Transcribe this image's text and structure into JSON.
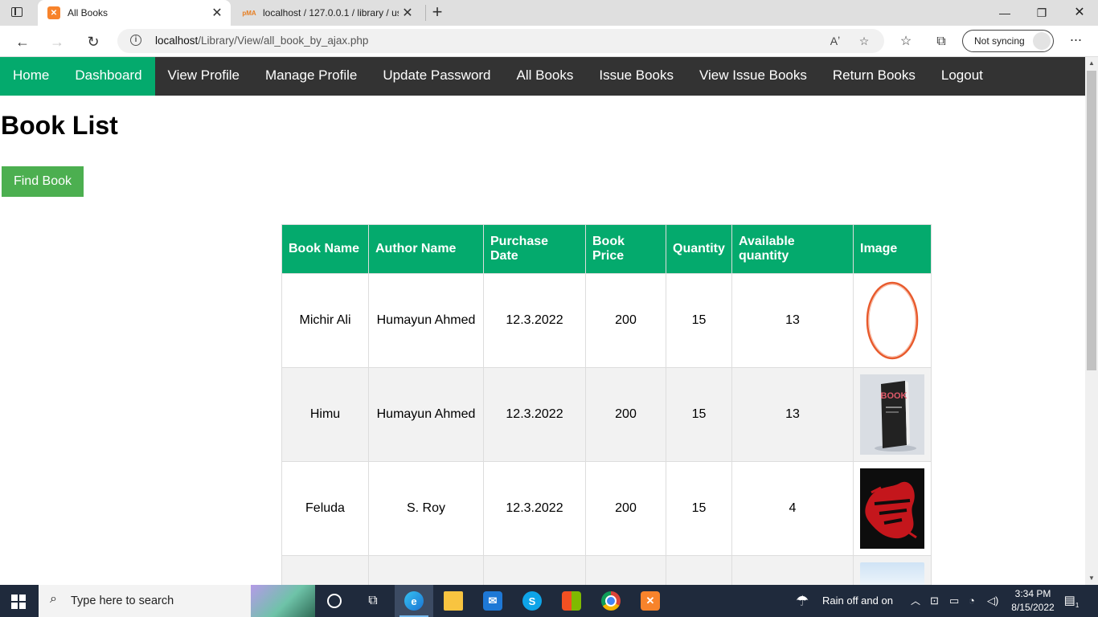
{
  "browser": {
    "tabs": [
      {
        "title": "All Books",
        "favicon": "xampp-icon",
        "active": true
      },
      {
        "title": "localhost / 127.0.0.1 / library / us",
        "favicon": "phpmyadmin-icon",
        "active": false
      }
    ],
    "url": {
      "host": "localhost",
      "path": "/Library/View/all_book_by_ajax.php"
    },
    "sync_label": "Not syncing"
  },
  "nav": {
    "items": [
      {
        "label": "Home",
        "highlighted": true
      },
      {
        "label": "Dashboard",
        "highlighted": true
      },
      {
        "label": "View Profile",
        "highlighted": false
      },
      {
        "label": "Manage Profile",
        "highlighted": false
      },
      {
        "label": "Update Password",
        "highlighted": false
      },
      {
        "label": "All Books",
        "highlighted": false
      },
      {
        "label": "Issue Books",
        "highlighted": false
      },
      {
        "label": "View Issue Books",
        "highlighted": false
      },
      {
        "label": "Return Books",
        "highlighted": false
      },
      {
        "label": "Logout",
        "highlighted": false
      }
    ]
  },
  "page": {
    "title": "Book List",
    "find_button": "Find Book"
  },
  "table": {
    "headers": {
      "book_name": "Book Name",
      "author_name": "Author Name",
      "purchase_date_1": "Purchase",
      "purchase_date_2": "Date",
      "book_price_1": "Book",
      "book_price_2": "Price",
      "quantity": "Quantity",
      "available_1": "Available",
      "available_2": "quantity",
      "image": "Image"
    },
    "rows": [
      {
        "book_name": "Michir Ali",
        "author": "Humayun Ahmed",
        "purchase_date": "12.3.2022",
        "price": "200",
        "quantity": "15",
        "available": "13",
        "image": "ring-cover-image"
      },
      {
        "book_name": "Himu",
        "author": "Humayun Ahmed",
        "purchase_date": "12.3.2022",
        "price": "200",
        "quantity": "15",
        "available": "13",
        "image": "book-mockup-cover-image",
        "cover_text": "BOOK"
      },
      {
        "book_name": "Feluda",
        "author": "S. Roy",
        "purchase_date": "12.3.2022",
        "price": "200",
        "quantity": "15",
        "available": "4",
        "image": "red-black-cover-image"
      }
    ]
  },
  "taskbar": {
    "search_placeholder": "Type here to search",
    "weather": "Rain off and on",
    "time": "3:34 PM",
    "date": "8/15/2022",
    "notification_count": "1"
  },
  "colors": {
    "nav_bg": "#333333",
    "nav_highlight": "#04aa6d",
    "table_header": "#04aa6d",
    "find_button": "#4caf50",
    "taskbar": "#1f2a3c"
  }
}
